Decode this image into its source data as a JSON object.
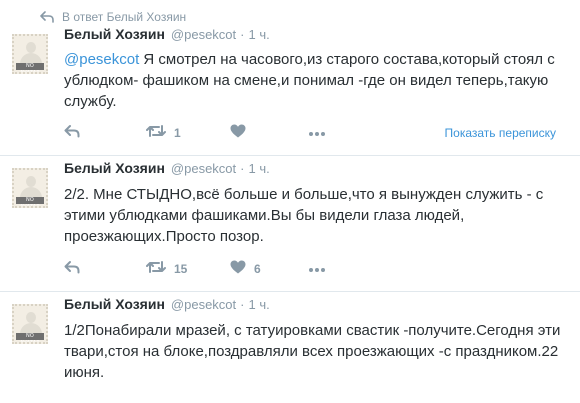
{
  "reply_context": {
    "label": "В ответ Белый Хозяин"
  },
  "avatar_text": "NO AVATAR",
  "tweets": [
    {
      "name": "Белый Хозяин",
      "handle": "@pesekcot",
      "separator": "·",
      "time": "1 ч.",
      "mention": "@pesekcot",
      "text": " Я смотрел на часового,из старого состава,который стоял с ублюдком- фашиком на смене,и понимал -где он видел теперь,такую службу.",
      "retweets": "1",
      "likes": "",
      "show_conversation": "Показать переписку"
    },
    {
      "name": "Белый Хозяин",
      "handle": "@pesekcot",
      "separator": "·",
      "time": "1 ч.",
      "text": "2/2. Мне СТЫДНО,всё больше и больше,что я вынужден служить - с этими ублюдками фашиками.Вы бы видели глаза людей, проезжающих.Просто позор.",
      "retweets": "15",
      "likes": "6"
    },
    {
      "name": "Белый Хозяин",
      "handle": "@pesekcot",
      "separator": "·",
      "time": "1 ч.",
      "text": "1/2Понабирали мразей, с татуировками свастик -получите.Сегодня эти твари,стоя на блоке,поздравляли всех проезжающих -с праздником.22 июня."
    }
  ],
  "colors": {
    "text": "#292f33",
    "muted": "#8899a6",
    "link": "#3b94d9",
    "divider": "#e1e8ed"
  },
  "icons": [
    "reply-arrow-icon",
    "reply-icon",
    "retweet-icon",
    "like-icon",
    "more-icon"
  ]
}
